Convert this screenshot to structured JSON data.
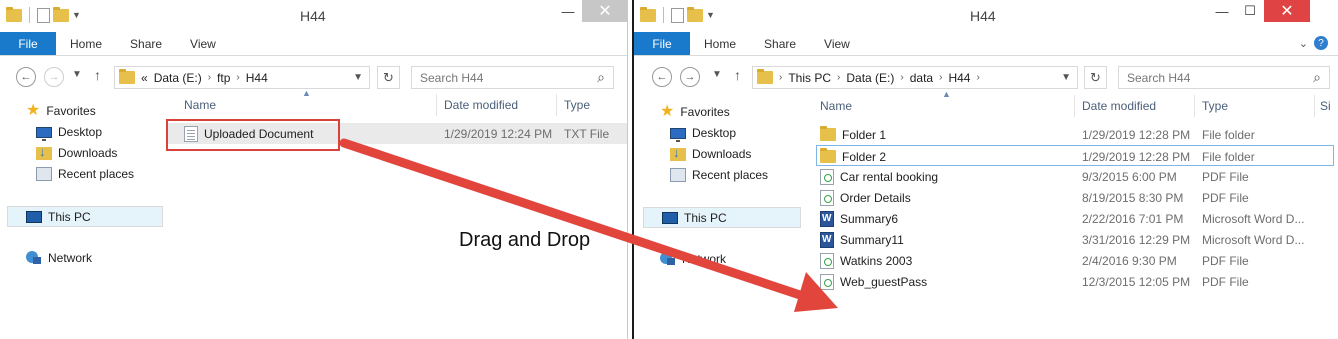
{
  "left_window": {
    "title": "H44",
    "ribbon_tabs": [
      "File",
      "Home",
      "Share",
      "View"
    ],
    "address": [
      "«",
      "Data (E:)",
      "ftp",
      "H44"
    ],
    "search_placeholder": "Search H44",
    "nav": {
      "favorites": "Favorites",
      "desktop": "Desktop",
      "downloads": "Downloads",
      "recent": "Recent places",
      "this_pc": "This PC",
      "network": "Network"
    },
    "columns": [
      "Name",
      "Date modified",
      "Type"
    ],
    "files": [
      {
        "name": "Uploaded Document",
        "date": "1/29/2019 12:24 PM",
        "type": "TXT File",
        "icon": "text-file-icon"
      }
    ]
  },
  "right_window": {
    "title": "H44",
    "ribbon_tabs": [
      "File",
      "Home",
      "Share",
      "View"
    ],
    "address": [
      "This PC",
      "Data (E:)",
      "data",
      "H44"
    ],
    "search_placeholder": "Search H44",
    "nav": {
      "favorites": "Favorites",
      "desktop": "Desktop",
      "downloads": "Downloads",
      "recent": "Recent places",
      "this_pc": "This PC",
      "network": "Network"
    },
    "columns": [
      "Name",
      "Date modified",
      "Type",
      "Si"
    ],
    "files": [
      {
        "name": "Folder 1",
        "date": "1/29/2019 12:28 PM",
        "type": "File folder",
        "icon": "folder-icon"
      },
      {
        "name": "Folder 2",
        "date": "1/29/2019 12:28 PM",
        "type": "File folder",
        "icon": "folder-icon"
      },
      {
        "name": "Car rental booking",
        "date": "9/3/2015 6:00 PM",
        "type": "PDF File",
        "icon": "pdf-file-icon"
      },
      {
        "name": "Order Details",
        "date": "8/19/2015 8:30 PM",
        "type": "PDF File",
        "icon": "pdf-file-icon"
      },
      {
        "name": "Summary6",
        "date": "2/22/2016 7:01 PM",
        "type": "Microsoft Word D...",
        "icon": "word-doc-icon"
      },
      {
        "name": "Summary11",
        "date": "3/31/2016 12:29 PM",
        "type": "Microsoft Word D...",
        "icon": "word-doc-icon"
      },
      {
        "name": "Watkins 2003",
        "date": "2/4/2016 9:30 PM",
        "type": "PDF File",
        "icon": "pdf-file-icon"
      },
      {
        "name": "Web_guestPass",
        "date": "12/3/2015 12:05 PM",
        "type": "PDF File",
        "icon": "pdf-file-icon"
      }
    ]
  },
  "annotation": {
    "label": "Drag and Drop",
    "arrow_color": "#e2453c"
  },
  "colors": {
    "file_tab": "#1979ca",
    "close_active": "#e04343",
    "highlight": "#d9423a"
  }
}
